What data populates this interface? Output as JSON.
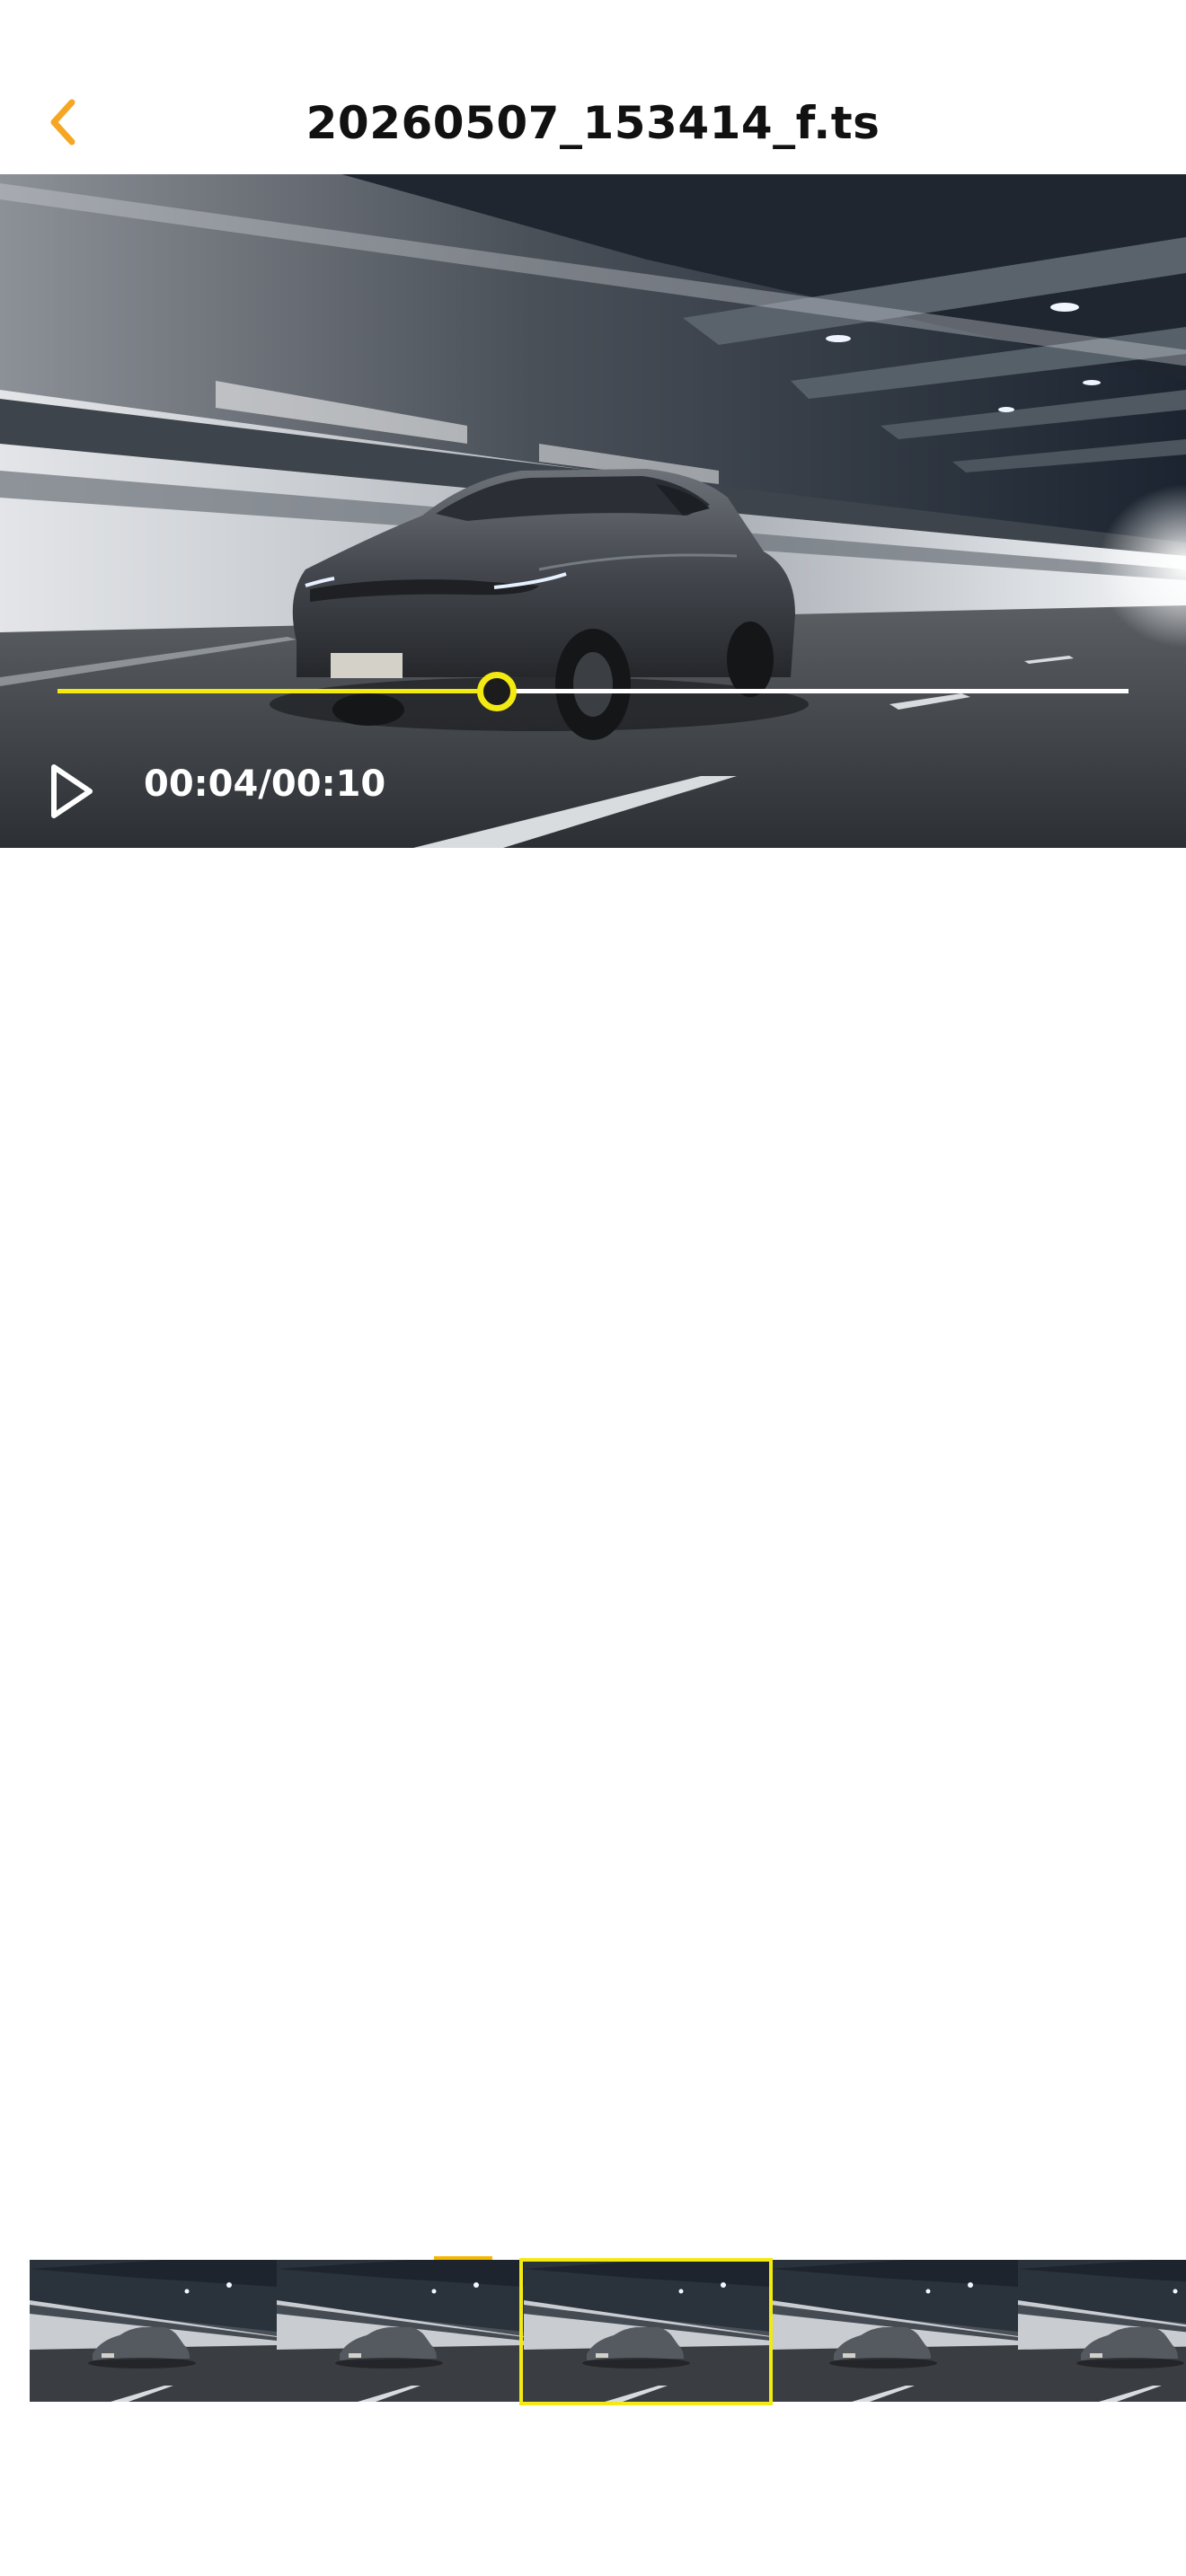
{
  "header": {
    "title": "20260507_153414_f.ts",
    "back_icon": "chevron-left-icon",
    "accent_color": "#F5A623"
  },
  "player": {
    "time_text": "00:04/00:10",
    "progress_fraction": 0.41,
    "play_icon": "play-icon",
    "played_color": "#F3EA12",
    "track_color": "#FFFFFF"
  },
  "filmstrip": {
    "frame_count": 6,
    "selected_index": 2,
    "highlight_color": "#F3EA12"
  }
}
